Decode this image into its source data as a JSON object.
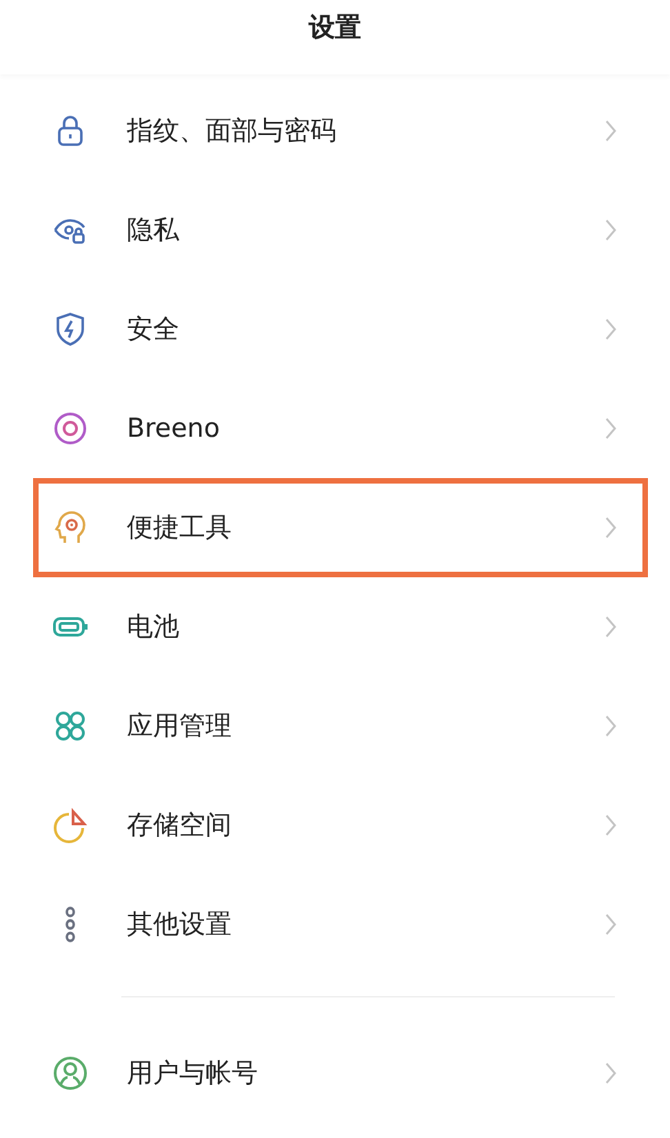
{
  "header": {
    "title": "设置"
  },
  "sections": [
    {
      "items": [
        {
          "label": "指纹、面部与密码",
          "highlighted": false
        },
        {
          "label": "隐私",
          "highlighted": false
        },
        {
          "label": "安全",
          "highlighted": false
        },
        {
          "label": "Breeno",
          "highlighted": false
        },
        {
          "label": "便捷工具",
          "highlighted": true
        },
        {
          "label": "电池",
          "highlighted": false
        },
        {
          "label": "应用管理",
          "highlighted": false
        },
        {
          "label": "存储空间",
          "highlighted": false
        },
        {
          "label": "其他设置",
          "highlighted": false
        }
      ]
    },
    {
      "items": [
        {
          "label": "用户与帐号",
          "highlighted": false
        }
      ]
    }
  ]
}
